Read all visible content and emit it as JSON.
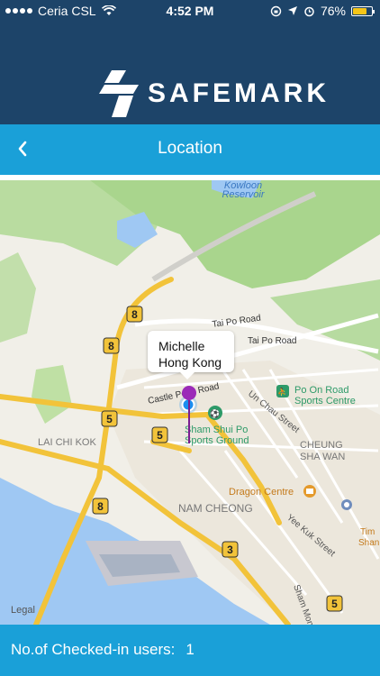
{
  "status_bar": {
    "carrier": "Ceria CSL",
    "time": "4:52 PM",
    "battery_percent": "76%",
    "battery_level": 0.76,
    "icons": [
      "signal-dots-icon",
      "wifi-icon",
      "orientation-lock-icon",
      "location-arrow-icon",
      "alarm-icon",
      "battery-icon"
    ]
  },
  "brand": {
    "name": "SAFEMARK",
    "logo_icon": "safemark-logo-icon"
  },
  "nav": {
    "title": "Location",
    "back_icon": "chevron-left-icon"
  },
  "map": {
    "callout": {
      "name": "Michelle",
      "place": "Hong Kong"
    },
    "labels": {
      "kowloon": "Kowloon",
      "reservoir": "Reservoir",
      "tai_po_road_1": "Tai Po Road",
      "tai_po_road_2": "Tai Po Road",
      "castle_peak_road": "Castle Peak Road",
      "un_chau_street": "Un Chau Street",
      "po_on_road": "Po On Road",
      "sports_centre": "Sports Centre",
      "sham_shui_po": "Sham Shui Po",
      "sports_ground": "Sports Ground",
      "cheung": "CHEUNG",
      "sha_wan": "SHA WAN",
      "lai_chi_kok": "LAI CHI KOK",
      "dragon_centre": "Dragon Centre",
      "nam_cheong": "NAM CHEONG",
      "yee_kuk_street": "Yee Kuk Street",
      "sham_mong": "Sham Mong",
      "tim": "Tim",
      "shan": "Shan",
      "legal": "Legal"
    },
    "route_shields": [
      "8",
      "8",
      "5",
      "5",
      "8",
      "3",
      "5"
    ],
    "colors": {
      "pin": "#9b2ab8",
      "user_dot": "#1a8ef0",
      "water": "#9fc8f3",
      "highway": "#f2c33a"
    }
  },
  "footer": {
    "label": "No.of Checked-in users:",
    "count": "1"
  },
  "colors": {
    "header": "#1d4469",
    "accent": "#1aa0d8"
  }
}
